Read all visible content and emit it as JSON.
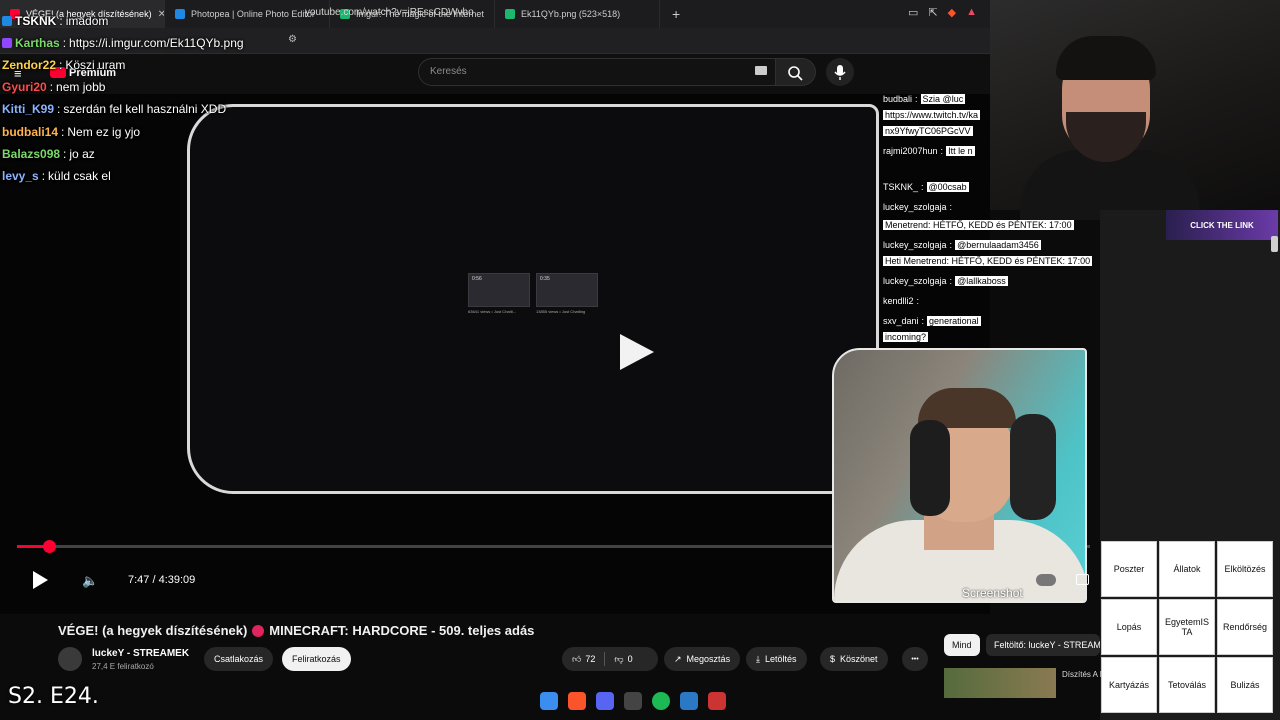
{
  "tabs": [
    {
      "label": "VÉGE! (a hegyek díszítésének)",
      "color": "#ff0033",
      "active": true
    },
    {
      "label": "Photopea | Online Photo Editor",
      "color": "#1e88e5",
      "active": false
    },
    {
      "label": "Imgur: The magic of the Internet",
      "color": "#1bb76e",
      "active": false
    },
    {
      "label": "Ek11QYb.png (523×518)",
      "color": "#1bb76e",
      "active": false
    }
  ],
  "new_tab": "+",
  "url": "youtube.com/watch?v=jREssCDWvho",
  "youtube": {
    "brand": "Premium",
    "search_placeholder": "Keresés"
  },
  "chat_overlay": [
    {
      "user": "Zendor22",
      "msg": "Köszi uram",
      "color": "#ffd24a"
    },
    {
      "user": "Gyuri20",
      "msg": "nem jobb",
      "color": "#ff4b4b"
    },
    {
      "user": "Kitti_K99",
      "msg": "szerdán fel kell használni XDD",
      "color": "#8ab4ff"
    },
    {
      "user": "budbali14",
      "msg": "Nem ez ig yjo",
      "color": "#ffb34a"
    },
    {
      "user": "Balazs098",
      "msg": "jo az",
      "color": "#7cd96b"
    },
    {
      "user": "levy_s",
      "msg": "küld csak el",
      "color": "#8ab4ff"
    }
  ],
  "chat_top": [
    {
      "user": "TSKNK",
      "msg": "imádom"
    },
    {
      "user": "Karthas",
      "msg": "https://i.imgur.com/Ek11QYb.png"
    }
  ],
  "right_chat": [
    {
      "user": "budbali",
      "msg": "Szia @luc"
    },
    {
      "user": "",
      "msg": "https://www.twitch.tv/ka"
    },
    {
      "user": "",
      "msg": "nx9YfwyTC06PGcVV"
    },
    {
      "user": "rajmi2007hun",
      "msg": "Itt le n"
    },
    {
      "user": "TSKNK_",
      "msg": "@00csab"
    },
    {
      "user": "luckey_szolgaja",
      "msg": ""
    },
    {
      "user": "",
      "msg": "Menetrend: HÉTFŐ, KEDD és PÉNTEK: 17:00"
    },
    {
      "user": "luckey_szolgaja",
      "msg": "@bernulaadam3456"
    },
    {
      "user": "",
      "msg": "Heti Menetrend: HÉTFŐ, KEDD és PÉNTEK: 17:00"
    },
    {
      "user": "luckey_szolgaja",
      "msg": "@lallkaboss"
    },
    {
      "user": "kendlli2",
      "msg": ""
    },
    {
      "user": "sxv_dani",
      "msg": "generational"
    },
    {
      "user": "",
      "msg": "incoming?"
    }
  ],
  "player": {
    "time": "7:47 / 4:39:09",
    "progress": 0.03,
    "screenshot_label": "Screenshot",
    "thumb1_time": "0:56",
    "thumb2_time": "0:35",
    "thumb1_views": "63641 views • Just Chatti...",
    "thumb2_views": "13855 views • Just Chatting"
  },
  "video": {
    "title": "VÉGE! (a hegyek díszítésének)",
    "title_rest": "MINECRAFT: HARDCORE - 509. teljes adás",
    "channel": "luckeY - STREAMEK",
    "subscribers": "27,4 E feliratkozó",
    "join": "Csatlakozás",
    "subscribe": "Feliratkozás",
    "likes": "72",
    "dislikes": "0",
    "share": "Megosztás",
    "download": "Letöltés",
    "thanks": "Köszönet",
    "more": "•••"
  },
  "sidebar_chips": {
    "all": "Mind",
    "uploader": "Feltöltő: luckeY - STREAM"
  },
  "recommend_label": "Díszítés A MINECRA",
  "click_link": "CLICK THE LINK",
  "grid": [
    "Poszter",
    "Állatok",
    "Elköltözés",
    "Lopás",
    "EgyetemIS TA",
    "Rendőrség",
    "Kartyázás",
    "Tetoválás",
    "Bulizás"
  ],
  "episode": "S2. E24."
}
